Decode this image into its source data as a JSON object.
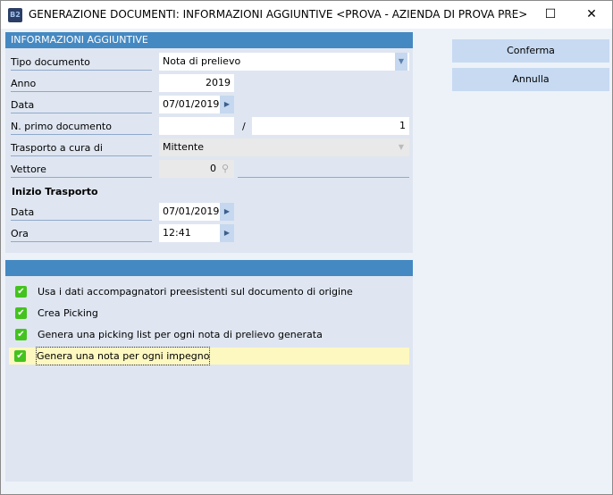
{
  "window": {
    "title": "GENERAZIONE DOCUMENTI: INFORMAZIONI AGGIUNTIVE <PROVA - AZIENDA DI PROVA PRE>",
    "icon_text": "B2"
  },
  "panel1": {
    "header": "INFORMAZIONI AGGIUNTIVE",
    "tipo_documento": {
      "label": "Tipo documento",
      "value": "Nota di prelievo"
    },
    "anno": {
      "label": "Anno",
      "value": "2019"
    },
    "data": {
      "label": "Data",
      "value": "07/01/2019"
    },
    "n_primo": {
      "label": "N. primo documento",
      "value": "",
      "separator": "/",
      "number": "1"
    },
    "trasporto": {
      "label": "Trasporto a cura di",
      "value": "Mittente"
    },
    "vettore": {
      "label": "Vettore",
      "value": "0"
    },
    "inizio_title": "Inizio Trasporto",
    "inizio_data": {
      "label": "Data",
      "value": "07/01/2019"
    },
    "inizio_ora": {
      "label": "Ora",
      "value": "12:41"
    }
  },
  "options": [
    {
      "label": "Usa i dati accompagnatori preesistenti sul documento di origine",
      "checked": true
    },
    {
      "label": "Crea Picking",
      "checked": true
    },
    {
      "label": "Genera una picking list per ogni nota di prelievo generata",
      "checked": true
    },
    {
      "label": "Genera una nota per ogni impegno",
      "checked": true
    }
  ],
  "buttons": {
    "confirm": "Conferma",
    "cancel": "Annulla"
  },
  "colors": {
    "header": "#4589c2",
    "checkbox": "#44c31f",
    "highlight": "#fdf8c0",
    "button": "#c7daf2"
  }
}
